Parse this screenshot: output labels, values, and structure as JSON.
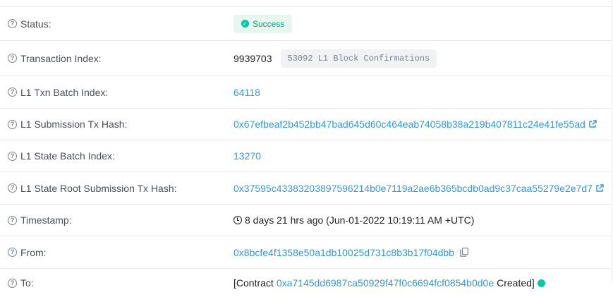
{
  "rows": {
    "status": {
      "label": "Status:",
      "badge": "Success"
    },
    "tx_index": {
      "label": "Transaction Index:",
      "value": "9939703",
      "confirmations": "53092 L1 Block Confirmations"
    },
    "l1_batch": {
      "label": "L1 Txn Batch Index:",
      "value": "64118"
    },
    "l1_submission": {
      "label": "L1 Submission Tx Hash:",
      "value": "0x67efbeaf2b452bb47bad645d60c464eab74058b38a219b407811c24e41fe55ad"
    },
    "l1_state_batch": {
      "label": "L1 State Batch Index:",
      "value": "13270"
    },
    "l1_state_root": {
      "label": "L1 State Root Submission Tx Hash:",
      "value": "0x37595c43383203897596214b0e7119a2ae6b365bcdb0ad9c37caa55279e2e7d7"
    },
    "timestamp": {
      "label": "Timestamp:",
      "value": "8 days 21 hrs ago (Jun-01-2022 10:19:11 AM +UTC)"
    },
    "from": {
      "label": "From:",
      "value": "0x8bcfe4f1358e50a1db10025d731c8b3b17f04dbb"
    },
    "to": {
      "label": "To:",
      "prefix": "[Contract",
      "value": "0xa7145dd6987ca50929f47f0c6694fcf0854b0d0e",
      "suffix": "Created]"
    }
  },
  "colors": {
    "link": "#3498db",
    "success": "#00a186",
    "border": "#e7eaf3"
  },
  "icons": {
    "help": "question-circle-icon",
    "check": "check-circle-icon",
    "external": "external-link-icon",
    "clock": "clock-icon",
    "copy": "copy-icon"
  }
}
